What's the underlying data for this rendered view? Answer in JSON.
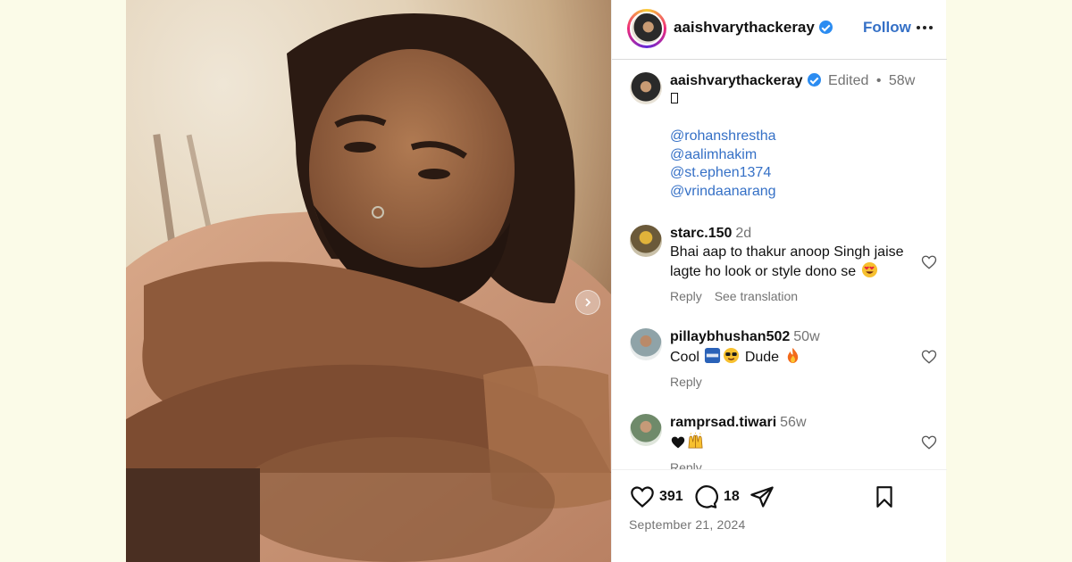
{
  "post": {
    "author": "aaishvarythackeray",
    "follow_label": "Follow",
    "caption": {
      "author": "aaishvarythackeray",
      "edited_label": "Edited",
      "separator": "•",
      "time": "58w",
      "mentions": [
        "@rohanshrestha",
        "@aalimhakim",
        "@st.ephen1374",
        "@vrindaanarang"
      ]
    },
    "comments": [
      {
        "user": "starc.150",
        "time": "2d",
        "text": "Bhai aap to thakur anoop Singh jaise lagte ho look or style dono se",
        "reply_label": "Reply",
        "translate_label": "See translation"
      },
      {
        "user": "pillaybhushan502",
        "time": "50w",
        "text_parts": [
          "Cool",
          "Dude"
        ],
        "reply_label": "Reply"
      },
      {
        "user": "ramprsad.tiwari",
        "time": "56w",
        "text": "",
        "reply_label": "Reply"
      }
    ],
    "likes": "391",
    "comment_count": "18",
    "date": "September 21, 2024"
  },
  "icons": {
    "verified": "verified-badge-icon",
    "more": "more-options-icon",
    "next": "chevron-right-icon",
    "heart": "heart-icon",
    "comment": "comment-icon",
    "share": "share-icon",
    "save": "bookmark-icon"
  },
  "colors": {
    "background": "#fbfbe8",
    "link": "#3570c6",
    "verified": "#2b8cf1",
    "muted": "#737373"
  }
}
